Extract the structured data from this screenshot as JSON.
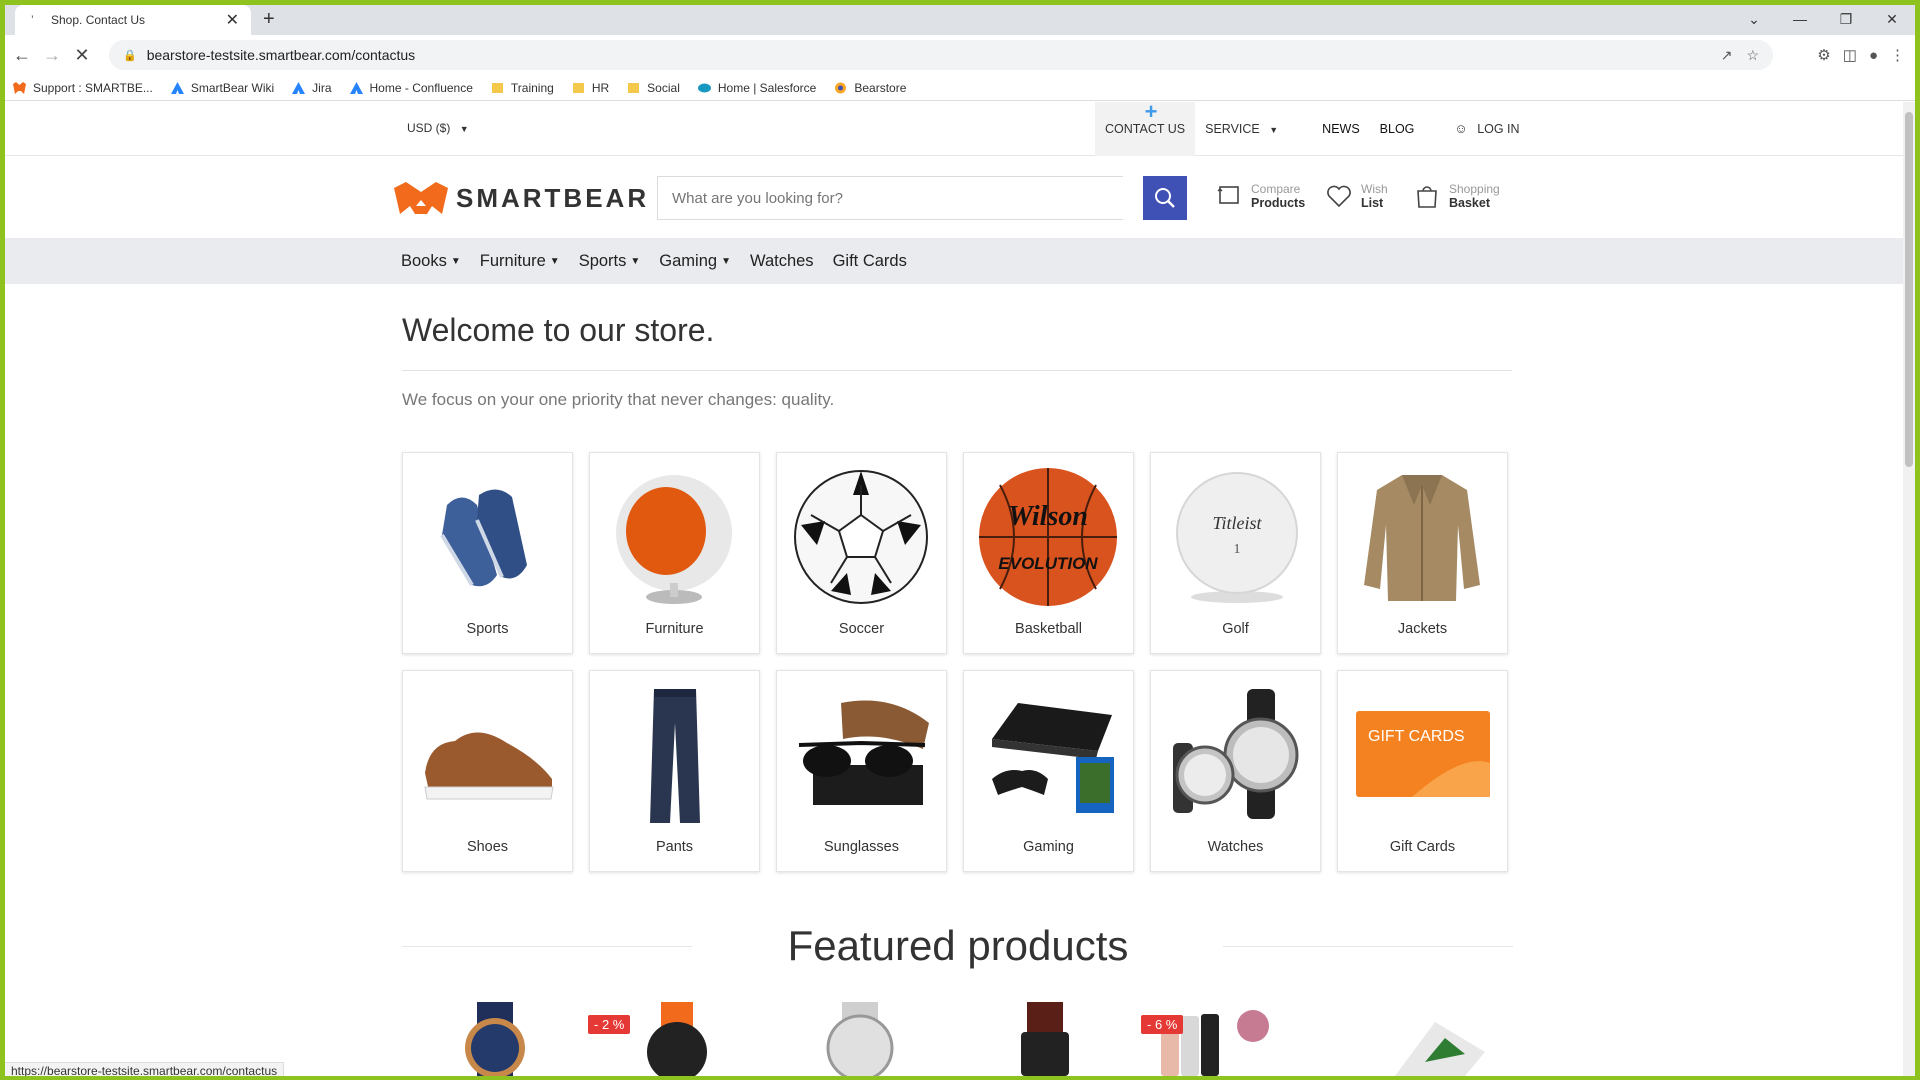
{
  "browser": {
    "tab_title": "Shop. Contact Us",
    "url": "bearstore-testsite.smartbear.com/contactus",
    "status_url": "https://bearstore-testsite.smartbear.com/contactus",
    "bookmarks": [
      {
        "label": "Support : SMARTBE...",
        "icon": "smartbear-icon"
      },
      {
        "label": "SmartBear Wiki",
        "icon": "atlassian-icon"
      },
      {
        "label": "Jira",
        "icon": "atlassian-icon"
      },
      {
        "label": "Home - Confluence",
        "icon": "atlassian-icon"
      },
      {
        "label": "Training",
        "icon": "folder-icon"
      },
      {
        "label": "HR",
        "icon": "folder-icon"
      },
      {
        "label": "Social",
        "icon": "folder-icon"
      },
      {
        "label": "Home | Salesforce",
        "icon": "salesforce-icon"
      },
      {
        "label": "Bearstore",
        "icon": "bearstore-icon"
      }
    ]
  },
  "topbar": {
    "currency": "USD  ($)",
    "contact": "CONTACT US",
    "service": "SERVICE",
    "news": "NEWS",
    "blog": "BLOG",
    "login": "LOG IN"
  },
  "header": {
    "logo_text": "SMARTBEAR",
    "search_placeholder": "What are you looking for?",
    "compare_small": "Compare",
    "compare_big": "Products",
    "wish_small": "Wish",
    "wish_big": "List",
    "basket_small": "Shopping",
    "basket_big": "Basket"
  },
  "menu": [
    "Books",
    "Furniture",
    "Sports",
    "Gaming",
    "Watches",
    "Gift Cards"
  ],
  "welcome": {
    "title": "Welcome to our store.",
    "subtitle": "We focus on your one priority that never changes: quality."
  },
  "categories": [
    "Sports",
    "Furniture",
    "Soccer",
    "Basketball",
    "Golf",
    "Jackets",
    "Shoes",
    "Pants",
    "Sunglasses",
    "Gaming",
    "Watches",
    "Gift Cards"
  ],
  "tile_art": {
    "basketball_brand": "Wilson",
    "basketball_model": "EVOLUTION",
    "golf_brand": "Titleist",
    "golf_number": "1",
    "giftcard_text": "GIFT CARDS"
  },
  "featured": {
    "title": "Featured products",
    "badges": [
      "- 2 %",
      "- 6 %"
    ]
  },
  "colors": {
    "accent": "#3f51b5",
    "brand_orange": "#f26a1b",
    "sale_red": "#e53935",
    "window_frame": "#8dc21f"
  }
}
